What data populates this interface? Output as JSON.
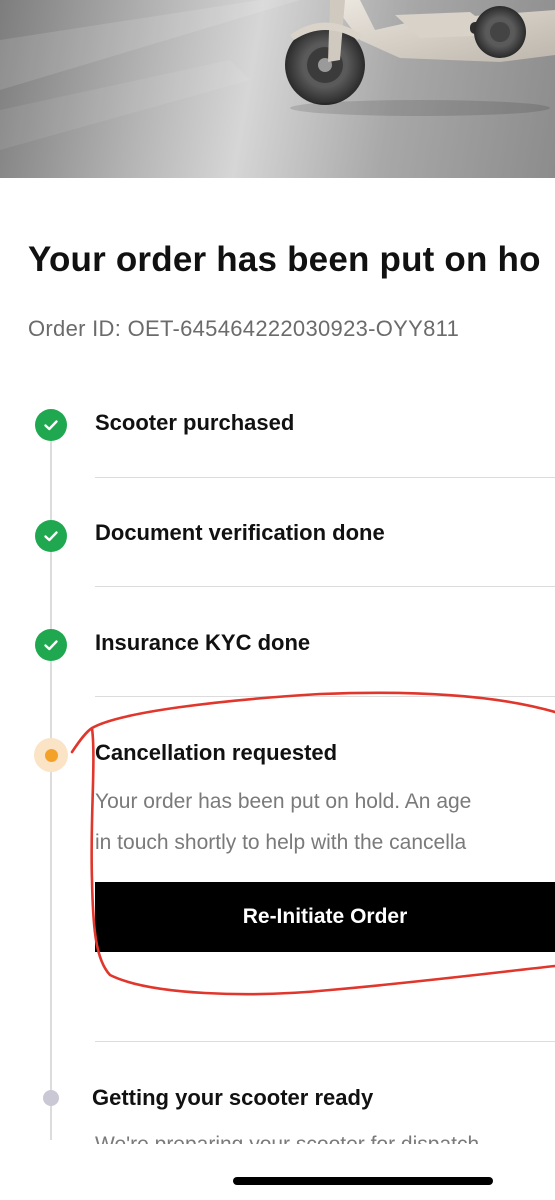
{
  "hero": {
    "image": "scooter"
  },
  "title": "Your order has been put on ho",
  "order_id": "Order ID: OET-645464222030923-OYY811",
  "steps": [
    {
      "label": "Scooter purchased",
      "status": "done"
    },
    {
      "label": "Document verification done",
      "status": "done"
    },
    {
      "label": "Insurance KYC done",
      "status": "done"
    },
    {
      "label": "Cancellation requested",
      "status": "current",
      "description_line1": "Your order has been put on hold. An age",
      "description_line2": "in touch shortly to help with the cancella",
      "button_label": "Re-Initiate Order"
    },
    {
      "label": "Getting your scooter ready",
      "status": "pending",
      "description_partial": "We're preparing your scooter for dispatch"
    }
  ],
  "colors": {
    "done": "#1fa84f",
    "current": "#f4a12a",
    "current_halo": "#fbe3c6",
    "pending": "#c9c8d4",
    "annotation": "#e0362c",
    "button_bg": "#000000"
  },
  "icons": {
    "done": "check-icon"
  }
}
